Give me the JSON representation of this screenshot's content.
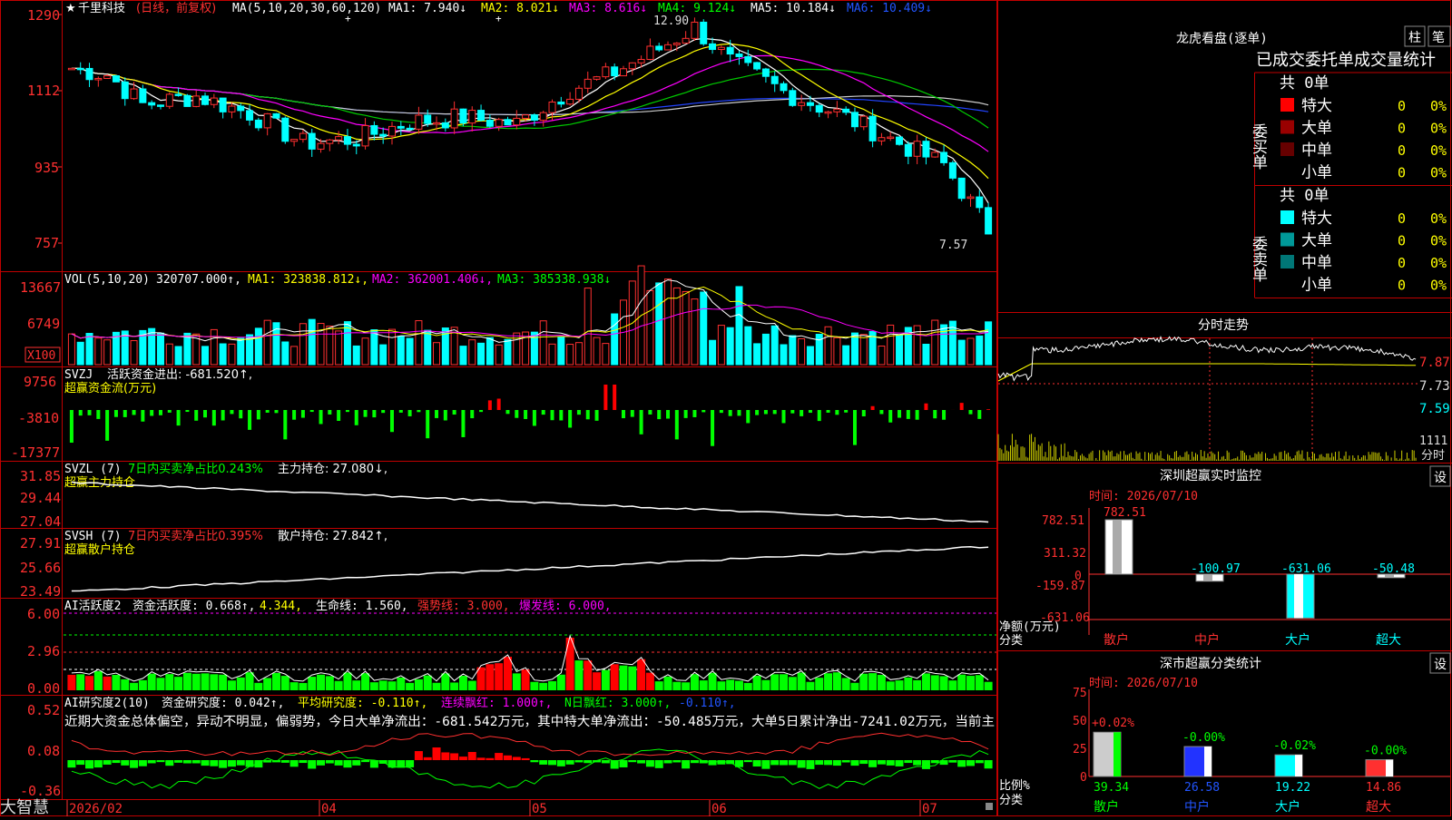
{
  "app": {
    "brand": "大智慧"
  },
  "header": {
    "star": "★",
    "stock": "千里科技",
    "mode": "(日线，前复权)",
    "ma_params": "MA(5,10,20,30,60,120)",
    "ma1": "MA1: 7.940↓",
    "ma2": "MA2: 8.021↓",
    "ma3": "MA3: 8.616↓",
    "ma4": "MA4: 9.124↓",
    "ma5": "MA5: 10.184↓",
    "ma6": "MA6: 10.409↓",
    "price_axis": [
      "1290",
      "1112",
      "935",
      "757"
    ],
    "high_mark": "12.90",
    "low_mark": "7.57"
  },
  "vol_panel": {
    "params": "VOL(5,10,20)",
    "value": "320707.000↑,",
    "ma1": "MA1: 323838.812↓,",
    "ma2": "MA2: 362001.406↓,",
    "ma3": "MA3: 385338.938↓",
    "axis": [
      "13667",
      "6749"
    ],
    "unit": "X100"
  },
  "svzj_panel": {
    "name": "SVZJ",
    "label": "活跃资金进出: -681.520↑,",
    "title": "超赢资金流(万元)",
    "axis": [
      "9756",
      "-3810",
      "-17377"
    ]
  },
  "svzl_panel": {
    "name": "SVZL (7)",
    "label1": "7日内买卖净占比0.243%",
    "label2": "主力持仓: 27.080↓,",
    "title": "超赢主力持仓",
    "axis": [
      "31.85",
      "29.44",
      "27.04"
    ]
  },
  "svsh_panel": {
    "name": "SVSH (7)",
    "label1": "7日内买卖净占比0.395%",
    "label2": "散户持仓: 27.842↑,",
    "title": "超赢散户持仓",
    "axis": [
      "27.91",
      "25.66",
      "23.49"
    ]
  },
  "ai1_panel": {
    "name": "AI活跃度2",
    "label1": "资金活跃度: 0.668↑,",
    "label2": "4.344,",
    "label3": "生命线: 1.560,",
    "label4": "强势线: 3.000,",
    "label5": "爆发线: 6.000,",
    "axis": [
      "6.00",
      "2.96",
      "0.00"
    ]
  },
  "ai2_panel": {
    "name": "AI研究度2(10)",
    "label1": "资金研究度: 0.042↑,",
    "label2": "平均研究度: -0.110↑,",
    "label3": "连续飘红: 1.000↑,",
    "label4": "N日飘红: 3.000↑,",
    "label5": "-0.110↑,",
    "comment": "近期大资金总体偏空，异动不明显，偏弱势，今日大单净流出：-681.542万元，其中特大单净流出：-50.485万元，大单5日累计净出-7241.02万元，当前主",
    "axis": [
      "0.52",
      "0.08",
      "-0.36"
    ]
  },
  "date_axis": [
    "2026/02",
    "04",
    "05",
    "06",
    "07"
  ],
  "dragon": {
    "title": "龙虎看盘(逐单)",
    "btn1": "柱",
    "btn2": "笔",
    "subtitle": "已成交委托单成交量统计",
    "buy": {
      "side": "委买单",
      "total": "共 0单",
      "rows": [
        {
          "name": "特大",
          "count": "0",
          "pct": "0%",
          "color": "#ff0000"
        },
        {
          "name": "大单",
          "count": "0",
          "pct": "0%",
          "color": "#990000"
        },
        {
          "name": "中单",
          "count": "0",
          "pct": "0%",
          "color": "#660000"
        },
        {
          "name": "小单",
          "count": "0",
          "pct": "0%",
          "color": "#000000"
        }
      ]
    },
    "sell": {
      "side": "委卖单",
      "total": "共 0单",
      "rows": [
        {
          "name": "特大",
          "count": "0",
          "pct": "0%",
          "color": "#00ffff"
        },
        {
          "name": "大单",
          "count": "0",
          "pct": "0%",
          "color": "#009999"
        },
        {
          "name": "中单",
          "count": "0",
          "pct": "0%",
          "color": "#007777"
        },
        {
          "name": "小单",
          "count": "0",
          "pct": "0%",
          "color": "#000000"
        }
      ]
    }
  },
  "intraday": {
    "title": "分时走势",
    "axis": [
      "7.87",
      "7.73",
      "7.59"
    ],
    "vol_label": "1111",
    "vol_unit": "分时"
  },
  "monitor": {
    "title": "深圳超赢实时监控",
    "set": "设",
    "time": "时间: 2026/07/10",
    "axis": [
      "782.51",
      "311.32",
      "0",
      "-159.87",
      "-631.06"
    ],
    "ylabel1": "净额(万元)",
    "ylabel2": "分类",
    "bars": [
      {
        "name": "散户",
        "value": "782.51"
      },
      {
        "name": "中户",
        "value": "-100.97"
      },
      {
        "name": "大户",
        "value": "-631.06"
      },
      {
        "name": "超大",
        "value": "-50.48"
      }
    ]
  },
  "classify": {
    "title": "深市超赢分类统计",
    "set": "设",
    "time": "时间: 2026/07/10",
    "axis": [
      "75",
      "50",
      "25",
      "0"
    ],
    "ylabel1": "比例%",
    "ylabel2": "分类",
    "bars": [
      {
        "name": "散户",
        "value": "39.34",
        "change": "+0.02%"
      },
      {
        "name": "中户",
        "value": "26.58",
        "change": "-0.00%"
      },
      {
        "name": "大户",
        "value": "19.22",
        "change": "-0.02%"
      },
      {
        "name": "超大",
        "value": "14.86",
        "change": "-0.00%"
      }
    ]
  }
}
